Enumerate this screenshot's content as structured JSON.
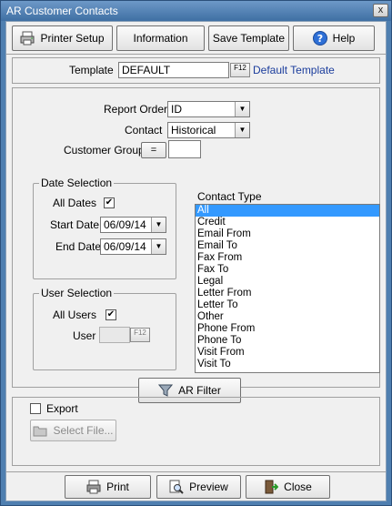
{
  "window": {
    "title": "AR Customer Contacts",
    "close_glyph": "x"
  },
  "toolbar": {
    "printer_setup": "Printer Setup",
    "information": "Information",
    "save_template": "Save Template",
    "help": "Help"
  },
  "template": {
    "label": "Template",
    "value": "DEFAULT",
    "lookup": "F12",
    "description": "Default Template"
  },
  "filters": {
    "report_order_label": "Report Order",
    "report_order_value": "ID",
    "contact_label": "Contact",
    "contact_value": "Historical",
    "customer_group_label": "Customer Group",
    "customer_group_operator": "=",
    "customer_group_value": ""
  },
  "date_selection": {
    "title": "Date Selection",
    "all_dates_label": "All Dates",
    "all_dates_checked": true,
    "start_date_label": "Start Date",
    "start_date_value": "06/09/14",
    "end_date_label": "End Date",
    "end_date_value": "06/09/14"
  },
  "user_selection": {
    "title": "User Selection",
    "all_users_label": "All Users",
    "all_users_checked": true,
    "user_label": "User",
    "user_value": "",
    "lookup": "F12"
  },
  "contact_type": {
    "label": "Contact Type",
    "selected": "All",
    "items": [
      "All",
      "Credit",
      "Email From",
      "Email To",
      "Fax From",
      "Fax To",
      "Legal",
      "Letter From",
      "Letter To",
      "Other",
      "Phone From",
      "Phone To",
      "Visit From",
      "Visit To"
    ]
  },
  "ar_filter": "AR Filter",
  "export": {
    "label": "Export",
    "checked": false,
    "select_file": "Select File..."
  },
  "footer": {
    "print": "Print",
    "preview": "Preview",
    "close": "Close"
  },
  "icons": {
    "printer_setup": "printer-setup-icon",
    "help": "help-icon",
    "filter": "filter-icon",
    "select_file": "folder-icon",
    "print": "print-icon",
    "preview": "preview-icon",
    "close": "exit-icon"
  },
  "colors": {
    "titlebar": "#4f7fb0",
    "selection": "#3399ff",
    "link_text": "#1a3c9c"
  }
}
